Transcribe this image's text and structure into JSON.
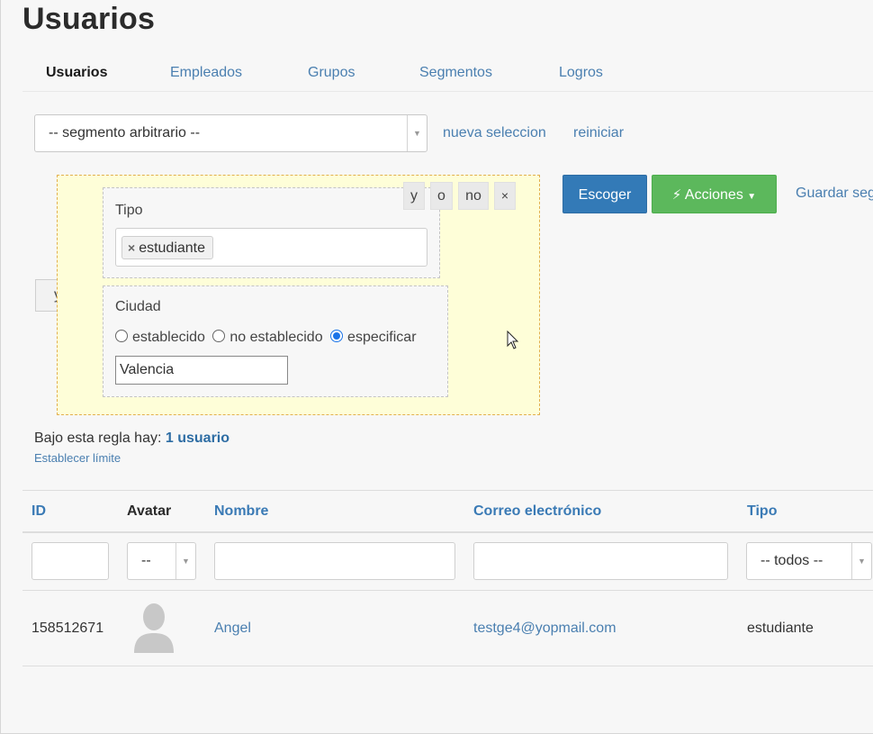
{
  "page": {
    "title": "Usuarios"
  },
  "tabs": [
    {
      "label": "Usuarios",
      "active": true
    },
    {
      "label": "Empleados"
    },
    {
      "label": "Grupos"
    },
    {
      "label": "Segmentos"
    },
    {
      "label": "Logros"
    }
  ],
  "segment": {
    "selected": "-- segmento arbitrario --",
    "new_selection": "nueva seleccion",
    "reset": "reiniciar"
  },
  "rule": {
    "outer_operator": "y",
    "ops": {
      "and": "y",
      "or": "o",
      "not": "no",
      "remove": "×"
    },
    "tipo": {
      "label": "Tipo",
      "tag": "estudiante",
      "tag_remove": "×"
    },
    "ciudad": {
      "label": "Ciudad",
      "options": [
        "establecido",
        "no establecido",
        "especificar"
      ],
      "selected": "especificar",
      "value": "Valencia"
    }
  },
  "actions": {
    "choose": "Escoger",
    "actions": "Acciones",
    "save": "Guardar seg"
  },
  "summary": {
    "prefix": "Bajo esta regla hay:",
    "count": "1 usuario",
    "limit": "Establecer límite"
  },
  "table": {
    "columns": [
      "ID",
      "Avatar",
      "Nombre",
      "Correo electrónico",
      "Tipo"
    ],
    "filters": {
      "avatar": "--",
      "tipo": "-- todos --"
    },
    "rows": [
      {
        "id": "158512671",
        "name": "Angel",
        "email": "testge4@yopmail.com",
        "type": "estudiante"
      }
    ]
  },
  "colors": {
    "primary": "#337ab7",
    "success": "#5cb85c",
    "link": "#4a7fb0",
    "rule_bg": "#fefed8"
  }
}
